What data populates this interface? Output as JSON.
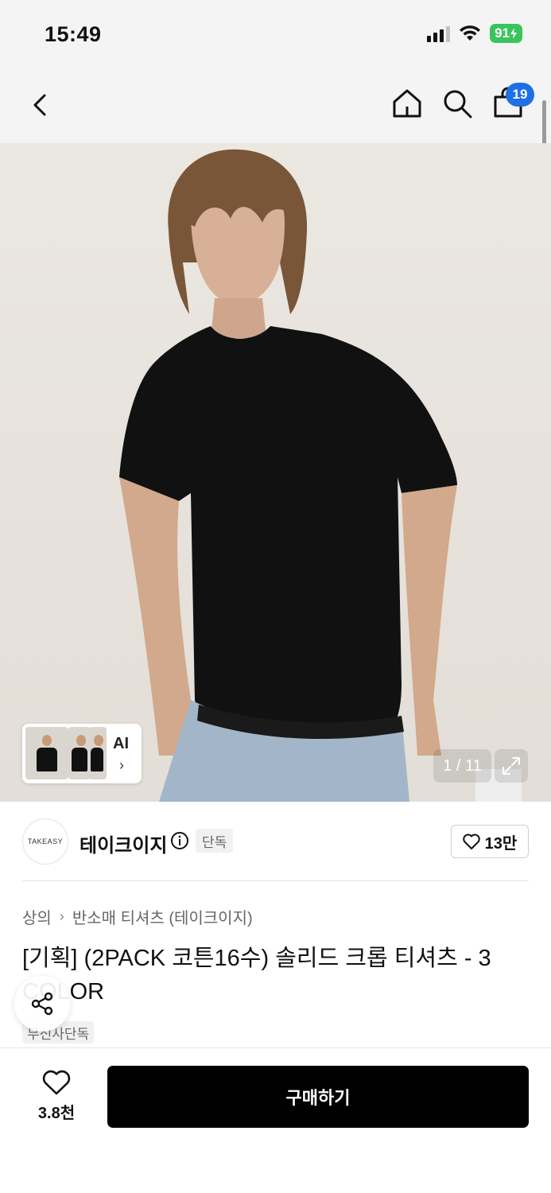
{
  "status_bar": {
    "time": "15:49",
    "battery": "91"
  },
  "nav": {
    "cart_count": "19"
  },
  "gallery": {
    "thumb_label": "AI",
    "counter": "1 / 11",
    "color_swatches": [
      "#eeeeee",
      "#8f8f8f",
      "#000000"
    ]
  },
  "brand": {
    "logo_text": "TAKEASY",
    "name": "테이크이지",
    "tag": "단독",
    "likes": "13만"
  },
  "breadcrumb": [
    "상의",
    "반소매 티셔츠 (테이크이지)"
  ],
  "product": {
    "title": "[기획] (2PACK 코튼16수) 솔리드 크롭 티셔츠 - 3 COLOR",
    "tag": "무신사단독"
  },
  "bottom": {
    "wish_count": "3.8천",
    "buy_label": "구매하기"
  }
}
